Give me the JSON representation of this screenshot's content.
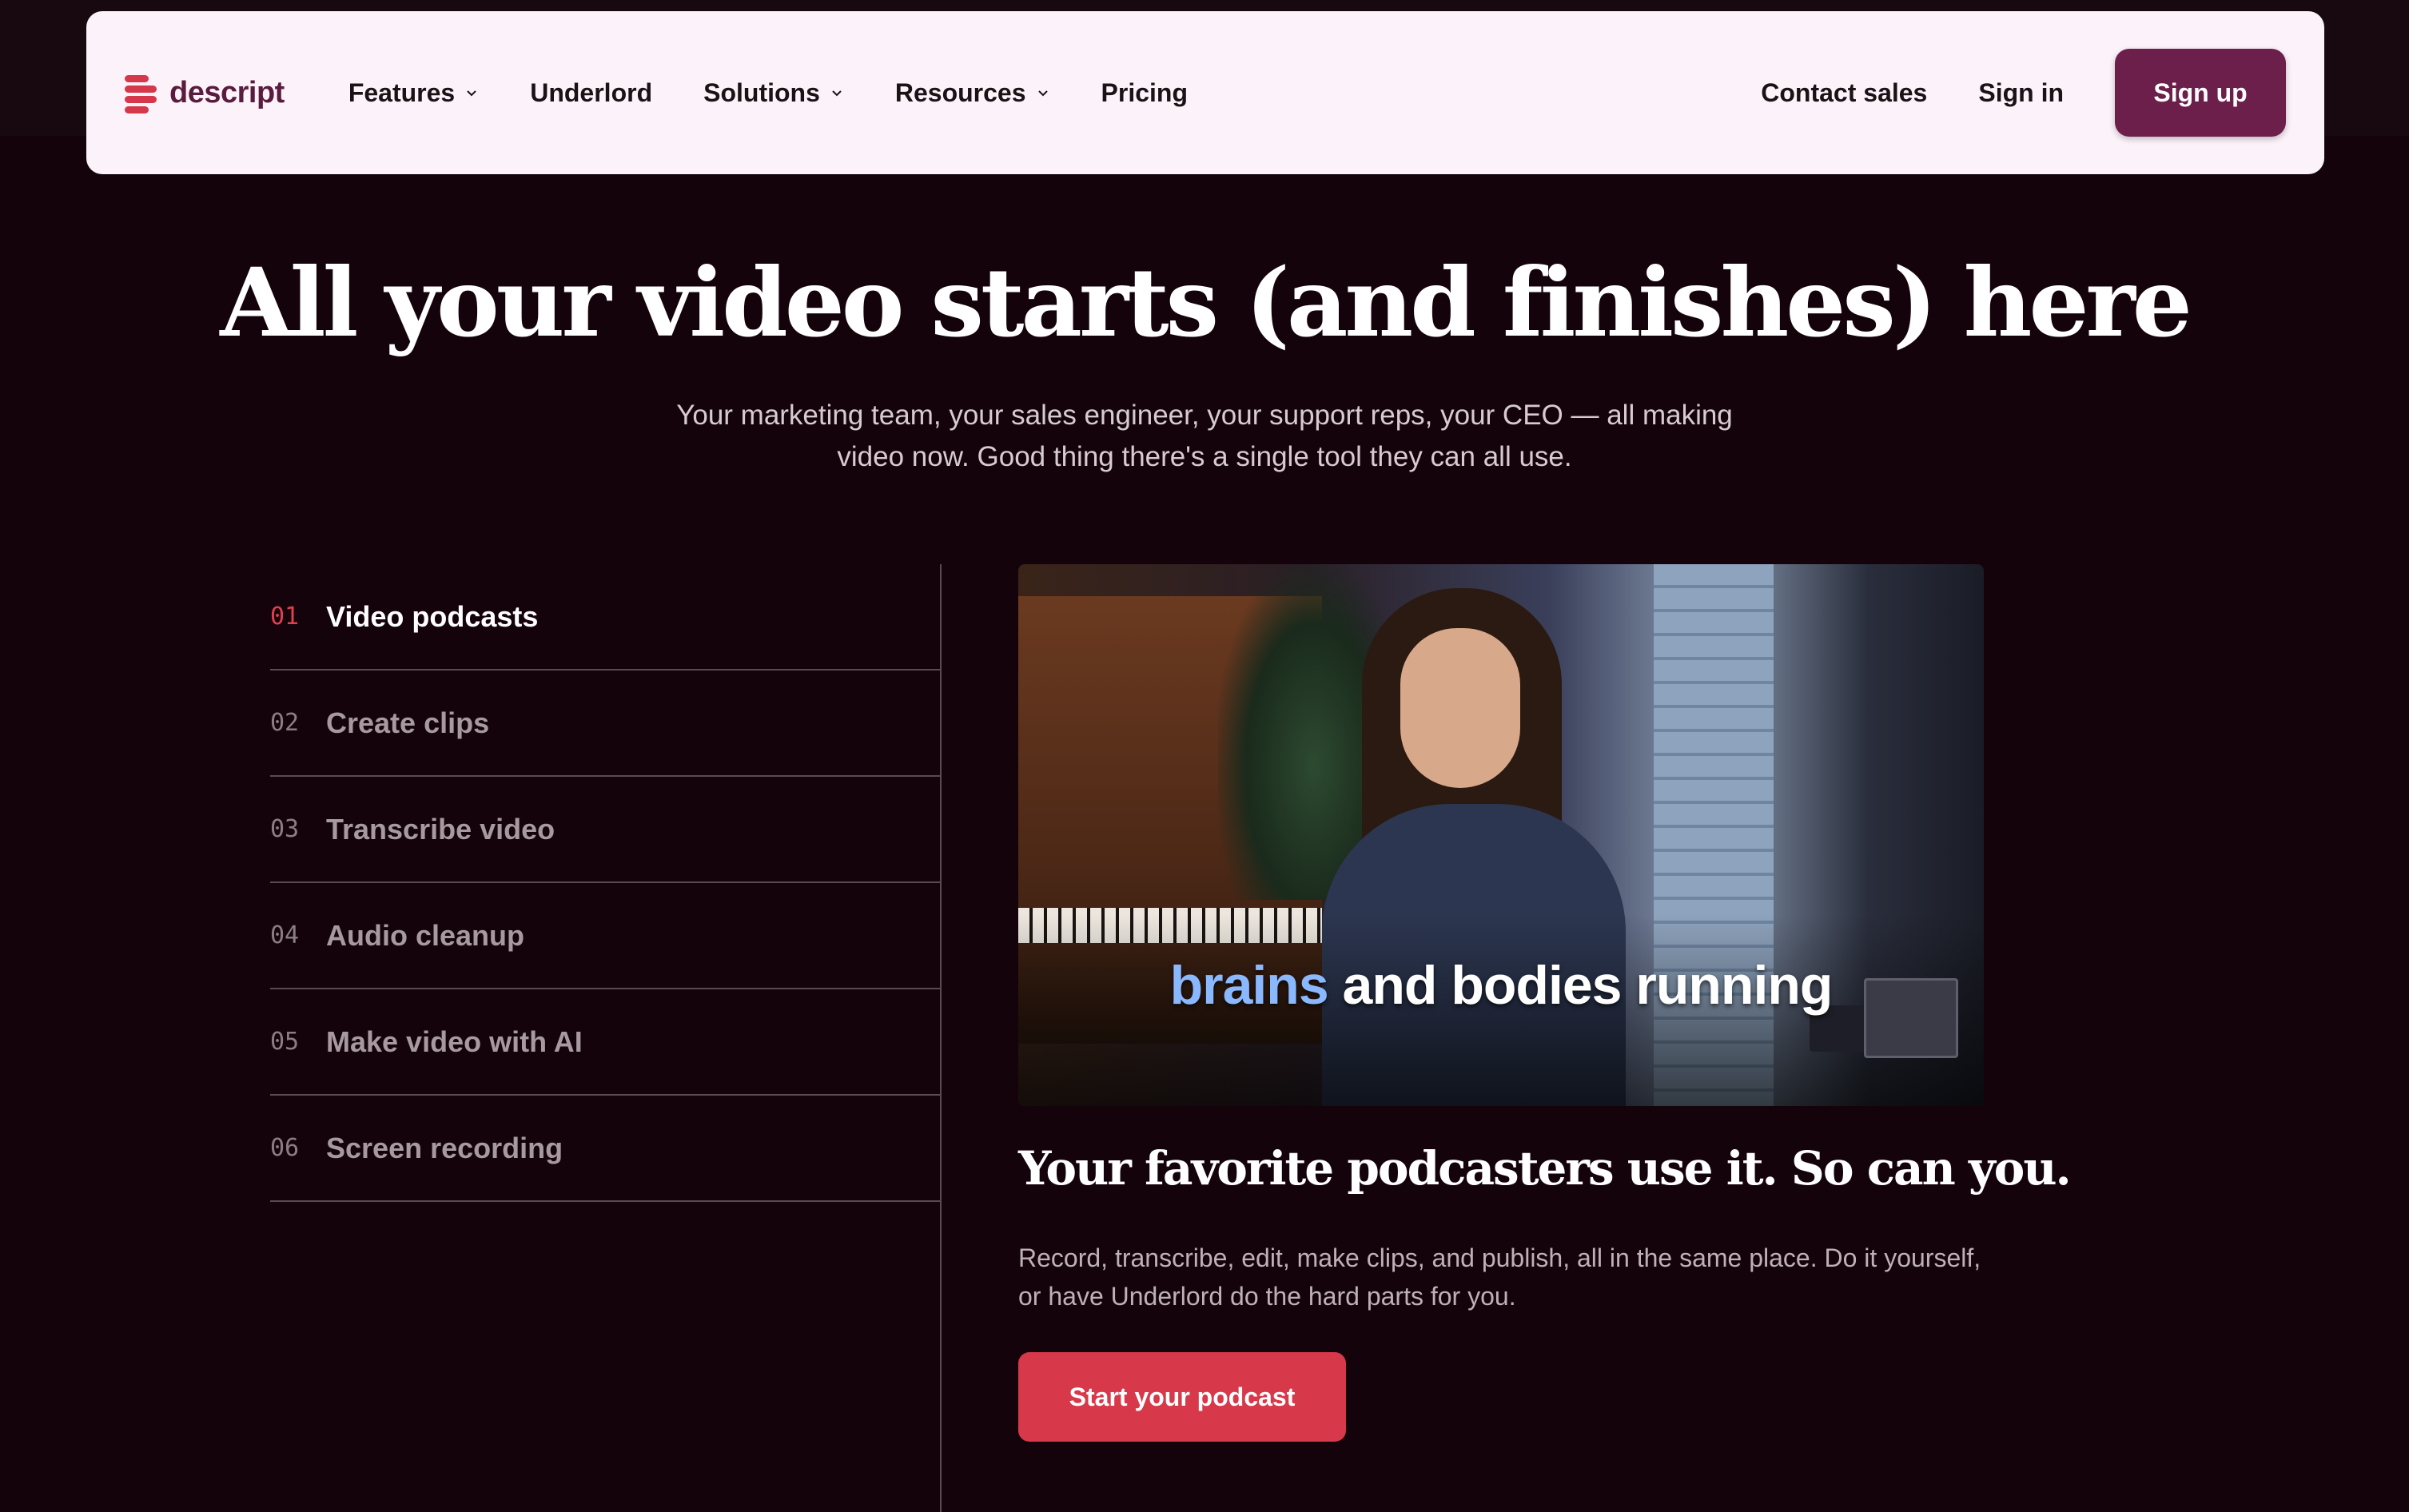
{
  "nav": {
    "brand": "descript",
    "links": [
      {
        "label": "Features",
        "dropdown": true
      },
      {
        "label": "Underlord",
        "dropdown": false
      },
      {
        "label": "Solutions",
        "dropdown": true
      },
      {
        "label": "Resources",
        "dropdown": true
      },
      {
        "label": "Pricing",
        "dropdown": false
      }
    ],
    "contact_sales": "Contact sales",
    "sign_in": "Sign in",
    "sign_up": "Sign up"
  },
  "hero": {
    "title": "All your video starts (and finishes) here",
    "subtitle": "Your marketing team, your sales engineer, your support reps, your CEO — all making video now. Good thing there's a single tool they can all use."
  },
  "use_cases": {
    "active_index": 0,
    "items": [
      {
        "num": "01",
        "label": "Video podcasts"
      },
      {
        "num": "02",
        "label": "Create clips"
      },
      {
        "num": "03",
        "label": "Transcribe video"
      },
      {
        "num": "04",
        "label": "Audio cleanup"
      },
      {
        "num": "05",
        "label": "Make video with AI"
      },
      {
        "num": "06",
        "label": "Screen recording"
      }
    ]
  },
  "video": {
    "caption_highlight": "brains",
    "caption_rest": " and bodies running"
  },
  "panel": {
    "title": "Your favorite podcasters use it. So can you.",
    "description": "Record, transcribe, edit, make clips, and publish, all in the same place. Do it yourself, or have Underlord do the hard parts for you.",
    "cta": "Start your podcast"
  },
  "colors": {
    "background": "#15030b",
    "nav_bg": "#fcf3fa",
    "signup_bg": "#6b1f4a",
    "accent_red": "#d8394a",
    "caption_highlight": "#8ab8ff"
  }
}
